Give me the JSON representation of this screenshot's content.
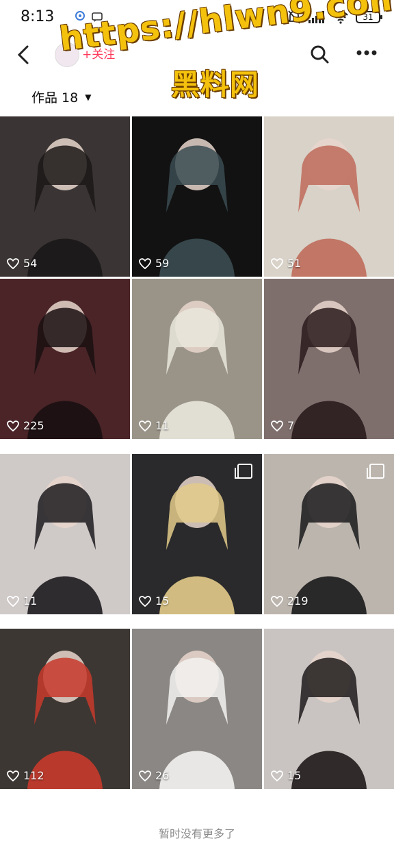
{
  "status_bar": {
    "time": "8:13",
    "battery": "31"
  },
  "nav": {
    "follow_label": "+关注"
  },
  "watermark": {
    "url": "https://hlwn9.com",
    "name": "黑料网"
  },
  "works": {
    "label": "作品 18"
  },
  "grid": [
    {
      "likes": "54",
      "multi": false,
      "bg": "#3a3534",
      "accent": "#1b1718"
    },
    {
      "likes": "59",
      "multi": false,
      "bg": "#121212",
      "accent": "#3b4c52"
    },
    {
      "likes": "51",
      "multi": false,
      "bg": "#d8d2c8",
      "accent": "#c06b5b"
    },
    {
      "likes": "225",
      "multi": false,
      "bg": "#4a2427",
      "accent": "#1a0f12"
    },
    {
      "likes": "11",
      "multi": false,
      "bg": "#9a9488",
      "accent": "#e9e6dd"
    },
    {
      "likes": "7",
      "multi": false,
      "bg": "#7e6f6d",
      "accent": "#2a1b1c"
    },
    {
      "likes": "11",
      "multi": false,
      "bg": "#cfc9c8",
      "accent": "#1d1b1f"
    },
    {
      "likes": "15",
      "multi": true,
      "bg": "#2a2a2c",
      "accent": "#e3cb8a"
    },
    {
      "likes": "219",
      "multi": true,
      "bg": "#bcb5ad",
      "accent": "#1a1a1c"
    },
    {
      "likes": "112",
      "multi": false,
      "bg": "#3d3733",
      "accent": "#c73a2b"
    },
    {
      "likes": "26",
      "multi": false,
      "bg": "#8a8784",
      "accent": "#f2f2f0"
    },
    {
      "likes": "15",
      "multi": false,
      "bg": "#c9c4c1",
      "accent": "#1f1a1b"
    }
  ],
  "footer": {
    "no_more": "暂时没有更多了"
  }
}
